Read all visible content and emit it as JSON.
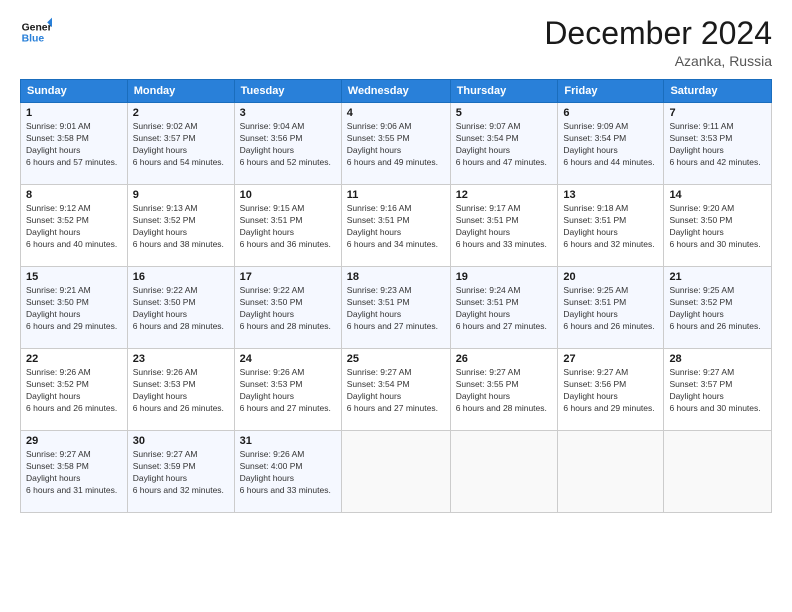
{
  "header": {
    "logo_line1": "General",
    "logo_line2": "Blue",
    "month_title": "December 2024",
    "location": "Azanka, Russia"
  },
  "days_of_week": [
    "Sunday",
    "Monday",
    "Tuesday",
    "Wednesday",
    "Thursday",
    "Friday",
    "Saturday"
  ],
  "weeks": [
    [
      {
        "day": 1,
        "sunrise": "9:01 AM",
        "sunset": "3:58 PM",
        "daylight": "6 hours and 57 minutes."
      },
      {
        "day": 2,
        "sunrise": "9:02 AM",
        "sunset": "3:57 PM",
        "daylight": "6 hours and 54 minutes."
      },
      {
        "day": 3,
        "sunrise": "9:04 AM",
        "sunset": "3:56 PM",
        "daylight": "6 hours and 52 minutes."
      },
      {
        "day": 4,
        "sunrise": "9:06 AM",
        "sunset": "3:55 PM",
        "daylight": "6 hours and 49 minutes."
      },
      {
        "day": 5,
        "sunrise": "9:07 AM",
        "sunset": "3:54 PM",
        "daylight": "6 hours and 47 minutes."
      },
      {
        "day": 6,
        "sunrise": "9:09 AM",
        "sunset": "3:54 PM",
        "daylight": "6 hours and 44 minutes."
      },
      {
        "day": 7,
        "sunrise": "9:11 AM",
        "sunset": "3:53 PM",
        "daylight": "6 hours and 42 minutes."
      }
    ],
    [
      {
        "day": 8,
        "sunrise": "9:12 AM",
        "sunset": "3:52 PM",
        "daylight": "6 hours and 40 minutes."
      },
      {
        "day": 9,
        "sunrise": "9:13 AM",
        "sunset": "3:52 PM",
        "daylight": "6 hours and 38 minutes."
      },
      {
        "day": 10,
        "sunrise": "9:15 AM",
        "sunset": "3:51 PM",
        "daylight": "6 hours and 36 minutes."
      },
      {
        "day": 11,
        "sunrise": "9:16 AM",
        "sunset": "3:51 PM",
        "daylight": "6 hours and 34 minutes."
      },
      {
        "day": 12,
        "sunrise": "9:17 AM",
        "sunset": "3:51 PM",
        "daylight": "6 hours and 33 minutes."
      },
      {
        "day": 13,
        "sunrise": "9:18 AM",
        "sunset": "3:51 PM",
        "daylight": "6 hours and 32 minutes."
      },
      {
        "day": 14,
        "sunrise": "9:20 AM",
        "sunset": "3:50 PM",
        "daylight": "6 hours and 30 minutes."
      }
    ],
    [
      {
        "day": 15,
        "sunrise": "9:21 AM",
        "sunset": "3:50 PM",
        "daylight": "6 hours and 29 minutes."
      },
      {
        "day": 16,
        "sunrise": "9:22 AM",
        "sunset": "3:50 PM",
        "daylight": "6 hours and 28 minutes."
      },
      {
        "day": 17,
        "sunrise": "9:22 AM",
        "sunset": "3:50 PM",
        "daylight": "6 hours and 28 minutes."
      },
      {
        "day": 18,
        "sunrise": "9:23 AM",
        "sunset": "3:51 PM",
        "daylight": "6 hours and 27 minutes."
      },
      {
        "day": 19,
        "sunrise": "9:24 AM",
        "sunset": "3:51 PM",
        "daylight": "6 hours and 27 minutes."
      },
      {
        "day": 20,
        "sunrise": "9:25 AM",
        "sunset": "3:51 PM",
        "daylight": "6 hours and 26 minutes."
      },
      {
        "day": 21,
        "sunrise": "9:25 AM",
        "sunset": "3:52 PM",
        "daylight": "6 hours and 26 minutes."
      }
    ],
    [
      {
        "day": 22,
        "sunrise": "9:26 AM",
        "sunset": "3:52 PM",
        "daylight": "6 hours and 26 minutes."
      },
      {
        "day": 23,
        "sunrise": "9:26 AM",
        "sunset": "3:53 PM",
        "daylight": "6 hours and 26 minutes."
      },
      {
        "day": 24,
        "sunrise": "9:26 AM",
        "sunset": "3:53 PM",
        "daylight": "6 hours and 27 minutes."
      },
      {
        "day": 25,
        "sunrise": "9:27 AM",
        "sunset": "3:54 PM",
        "daylight": "6 hours and 27 minutes."
      },
      {
        "day": 26,
        "sunrise": "9:27 AM",
        "sunset": "3:55 PM",
        "daylight": "6 hours and 28 minutes."
      },
      {
        "day": 27,
        "sunrise": "9:27 AM",
        "sunset": "3:56 PM",
        "daylight": "6 hours and 29 minutes."
      },
      {
        "day": 28,
        "sunrise": "9:27 AM",
        "sunset": "3:57 PM",
        "daylight": "6 hours and 30 minutes."
      }
    ],
    [
      {
        "day": 29,
        "sunrise": "9:27 AM",
        "sunset": "3:58 PM",
        "daylight": "6 hours and 31 minutes."
      },
      {
        "day": 30,
        "sunrise": "9:27 AM",
        "sunset": "3:59 PM",
        "daylight": "6 hours and 32 minutes."
      },
      {
        "day": 31,
        "sunrise": "9:26 AM",
        "sunset": "4:00 PM",
        "daylight": "6 hours and 33 minutes."
      },
      null,
      null,
      null,
      null
    ]
  ],
  "labels": {
    "sunrise": "Sunrise:",
    "sunset": "Sunset:",
    "daylight": "Daylight hours"
  }
}
